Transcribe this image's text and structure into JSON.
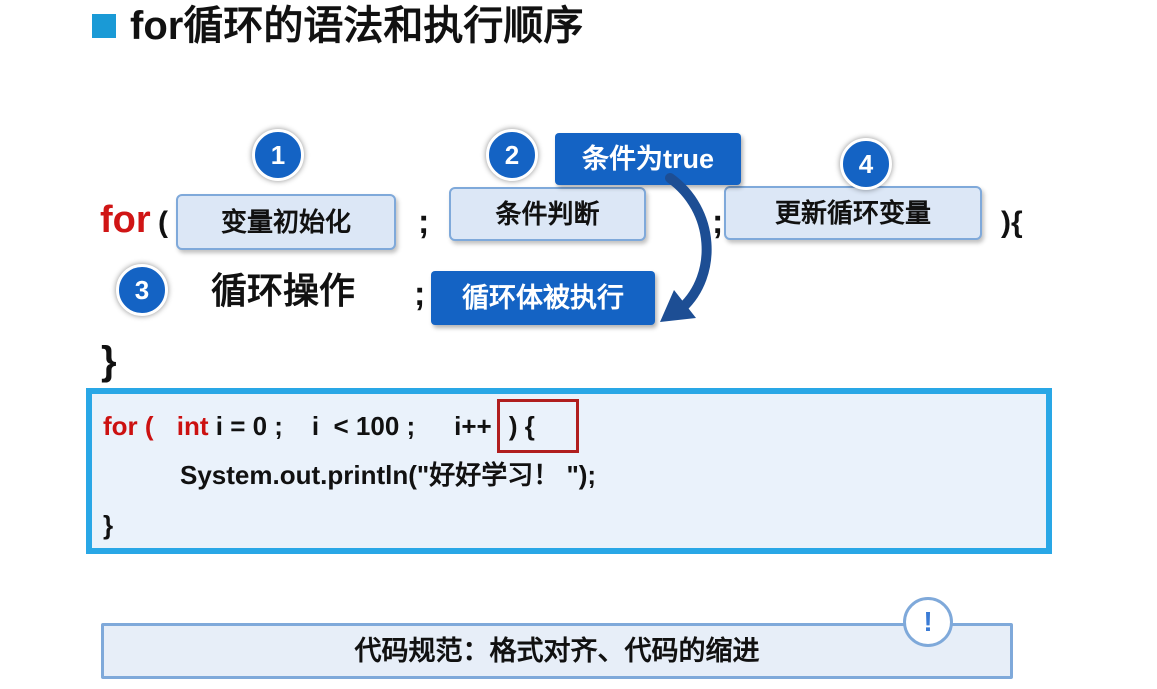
{
  "slide": {
    "title": "for循环的语法和执行顺序"
  },
  "syntax": {
    "for_kw": "for",
    "open_paren": "(",
    "semi1": ";",
    "semi2": ";",
    "close": "){",
    "step1_label": "变量初始化",
    "step2_label": "条件判断",
    "step4_label": "更新循环变量",
    "step3_label": "循环操作",
    "semi3": ";",
    "close_brace": "}",
    "badge1": "1",
    "badge2": "2",
    "badge3": "3",
    "badge4": "4",
    "tag_true": "条件为true",
    "tag_exec": "循环体被执行"
  },
  "code": {
    "line1_for": "for ( ",
    "line1_int": "int",
    "line1_rest": " i = 0 ;    i  < 100 ;    ",
    "line1_incr": "i++",
    "line1_end": " ) {",
    "line2": "System.out.println(\"好好学习！ \");",
    "line3": "}"
  },
  "note": {
    "text": "代码规范：格式对齐、代码的缩进",
    "alert": "!"
  },
  "colors": {
    "accent": "#1463c4",
    "keyword": "#d01515",
    "code_border": "#29a7e6"
  }
}
